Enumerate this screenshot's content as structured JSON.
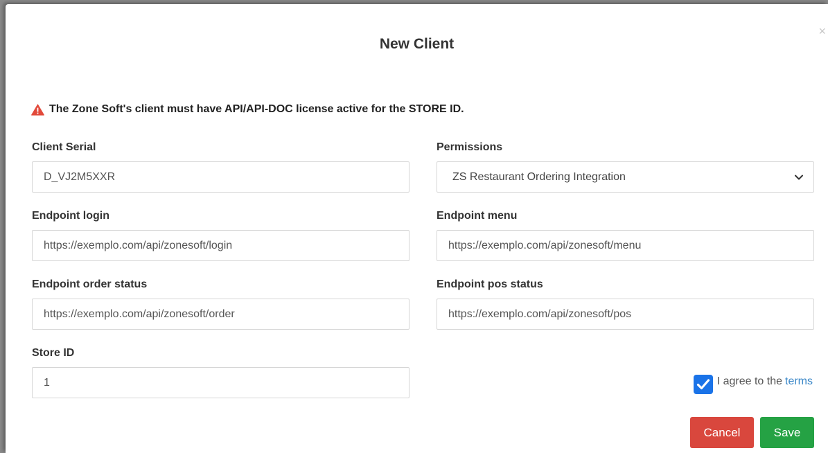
{
  "modal": {
    "title": "New Client",
    "close_glyph": "×"
  },
  "warning": {
    "icon": "warning-triangle-icon",
    "text": "The Zone Soft's client must have API/API-DOC license active for the STORE ID."
  },
  "form": {
    "client_serial": {
      "label": "Client Serial",
      "value": "D_VJ2M5XXR"
    },
    "permissions": {
      "label": "Permissions",
      "selected": "ZS Restaurant Ordering Integration"
    },
    "endpoint_login": {
      "label": "Endpoint login",
      "value": "https://exemplo.com/api/zonesoft/login"
    },
    "endpoint_menu": {
      "label": "Endpoint menu",
      "value": "https://exemplo.com/api/zonesoft/menu"
    },
    "endpoint_order_status": {
      "label": "Endpoint order status",
      "value": "https://exemplo.com/api/zonesoft/order"
    },
    "endpoint_pos_status": {
      "label": "Endpoint pos status",
      "value": "https://exemplo.com/api/zonesoft/pos"
    },
    "store_id": {
      "label": "Store ID",
      "value": "1"
    }
  },
  "agree": {
    "checked": true,
    "text": "I agree to the",
    "link": "terms"
  },
  "buttons": {
    "cancel": "Cancel",
    "save": "Save"
  },
  "colors": {
    "warning": "#e24a3b",
    "checkbox": "#1a73e8",
    "link": "#3a87c8",
    "cancel": "#d9473d",
    "save": "#25a244"
  }
}
